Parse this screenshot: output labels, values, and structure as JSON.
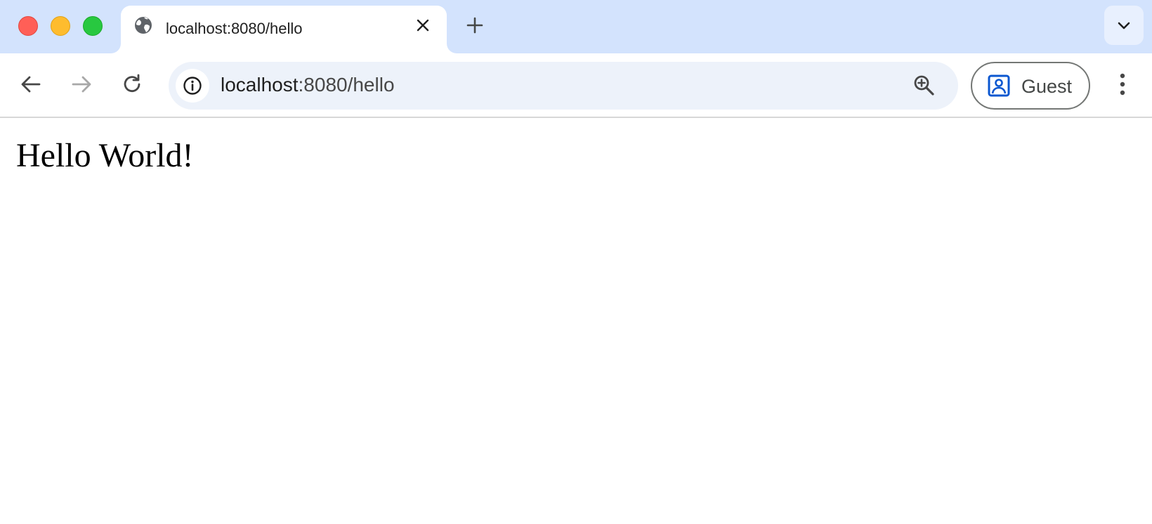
{
  "window": {
    "traffic_lights": {
      "close_color": "#ff5f57",
      "minimize_color": "#febc2e",
      "maximize_color": "#28c840"
    }
  },
  "tabs": [
    {
      "title": "localhost:8080/hello",
      "favicon": "globe-icon",
      "active": true
    }
  ],
  "tabstrip": {
    "new_tab_icon": "plus-icon",
    "tab_search_icon": "chevron-down-icon"
  },
  "toolbar": {
    "back_icon": "arrow-left-icon",
    "forward_icon": "arrow-right-icon",
    "forward_enabled": false,
    "reload_icon": "reload-icon"
  },
  "omnibox": {
    "site_info_icon": "info-icon",
    "url_host": "localhost",
    "url_rest": ":8080/hello",
    "zoom_icon": "zoom-in-icon"
  },
  "profile": {
    "label": "Guest",
    "icon": "guest-profile-icon",
    "icon_color": "#0b57d0"
  },
  "menu": {
    "icon": "kebab-menu-icon"
  },
  "page": {
    "heading": "Hello World!"
  },
  "colors": {
    "tabstrip_bg": "#d3e3fd",
    "omnibox_bg": "#edf2fa",
    "accent": "#0b57d0"
  }
}
